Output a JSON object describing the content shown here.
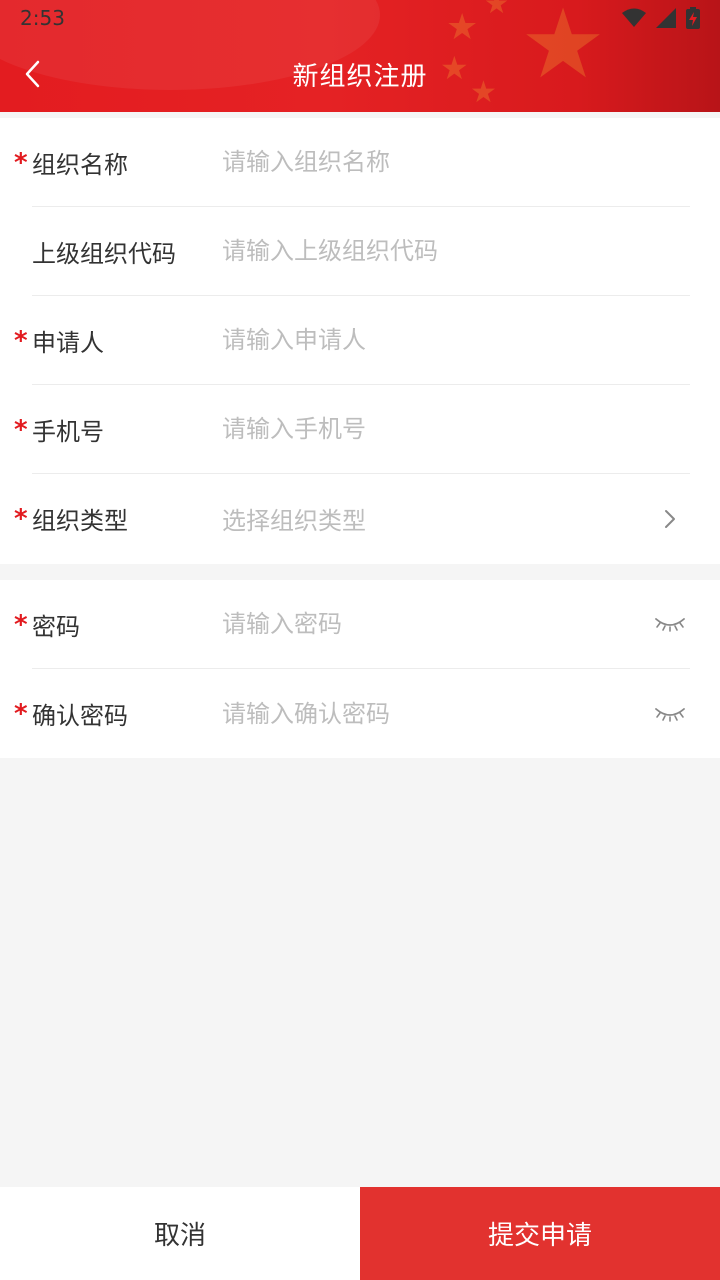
{
  "status_bar": {
    "time": "2:53",
    "icons": [
      "wifi-icon",
      "signal-icon",
      "battery-charging-icon"
    ]
  },
  "header": {
    "title": "新组织注册",
    "back_icon": "chevron-left-icon",
    "bg_color": "#e31c20"
  },
  "form": {
    "org_name": {
      "label": "组织名称",
      "placeholder": "请输入组织名称",
      "required": true
    },
    "parent_code": {
      "label": "上级组织代码",
      "placeholder": "请输入上级组织代码",
      "required": false
    },
    "applicant": {
      "label": "申请人",
      "placeholder": "请输入申请人",
      "required": true
    },
    "phone": {
      "label": "手机号",
      "placeholder": "请输入手机号",
      "required": true
    },
    "org_type": {
      "label": "组织类型",
      "placeholder": "选择组织类型",
      "required": true,
      "icon": "chevron-right-icon"
    },
    "password": {
      "label": "密码",
      "placeholder": "请输入密码",
      "required": true,
      "icon": "eye-closed-icon"
    },
    "confirm_password": {
      "label": "确认密码",
      "placeholder": "请输入确认密码",
      "required": true,
      "icon": "eye-closed-icon"
    },
    "required_mark": "*"
  },
  "actions": {
    "cancel_label": "取消",
    "submit_label": "提交申请",
    "submit_color": "#e2322f"
  }
}
